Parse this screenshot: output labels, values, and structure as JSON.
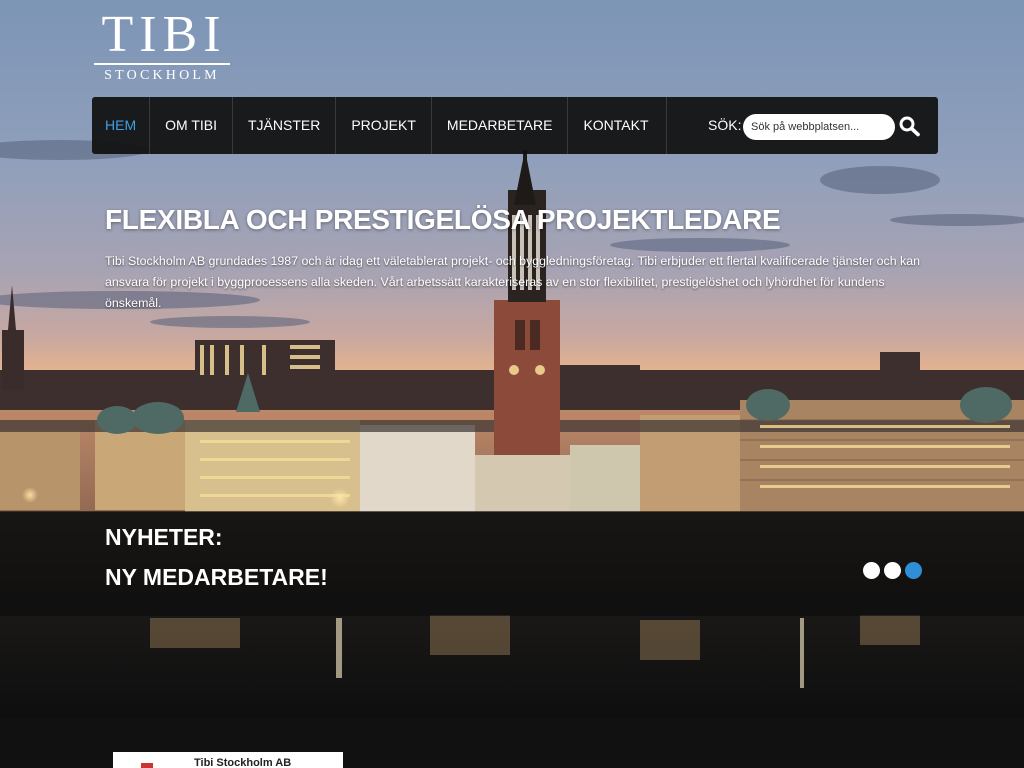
{
  "logo": {
    "main": "TIBI",
    "sub": "STOCKHOLM"
  },
  "nav": {
    "items": [
      {
        "label": "HEM",
        "active": true
      },
      {
        "label": "OM TIBI",
        "active": false
      },
      {
        "label": "TJÄNSTER",
        "active": false
      },
      {
        "label": "PROJEKT",
        "active": false
      },
      {
        "label": "MEDARBETARE",
        "active": false
      },
      {
        "label": "KONTAKT",
        "active": false
      }
    ],
    "active_color": "#3ea0e6"
  },
  "search": {
    "label": "SÖK:",
    "placeholder": "Sök på webbplatsen...",
    "icon": "search-icon"
  },
  "hero": {
    "title": "FLEXIBLA OCH PRESTIGELÖSA PROJEKTLEDARE",
    "text": "Tibi Stockholm AB grundades 1987 och är idag ett väletablerat projekt- och byggledningsföretag. Tibi erbjuder ett flertal kvalificerade tjänster och kan ansvara för projekt i byggprocessens alla skeden. Vårt arbetssätt karakteriseras av en stor flexibilitet, prestigelöshet och lyhördhet för kundens önskemål."
  },
  "news": {
    "heading": "NYHETER:",
    "title": "NY MEDARBETARE!",
    "slides": 3,
    "active_slide": 3,
    "active_color": "#2e8fd6"
  },
  "footer_card": {
    "label": "Tibi Stockholm AB"
  }
}
